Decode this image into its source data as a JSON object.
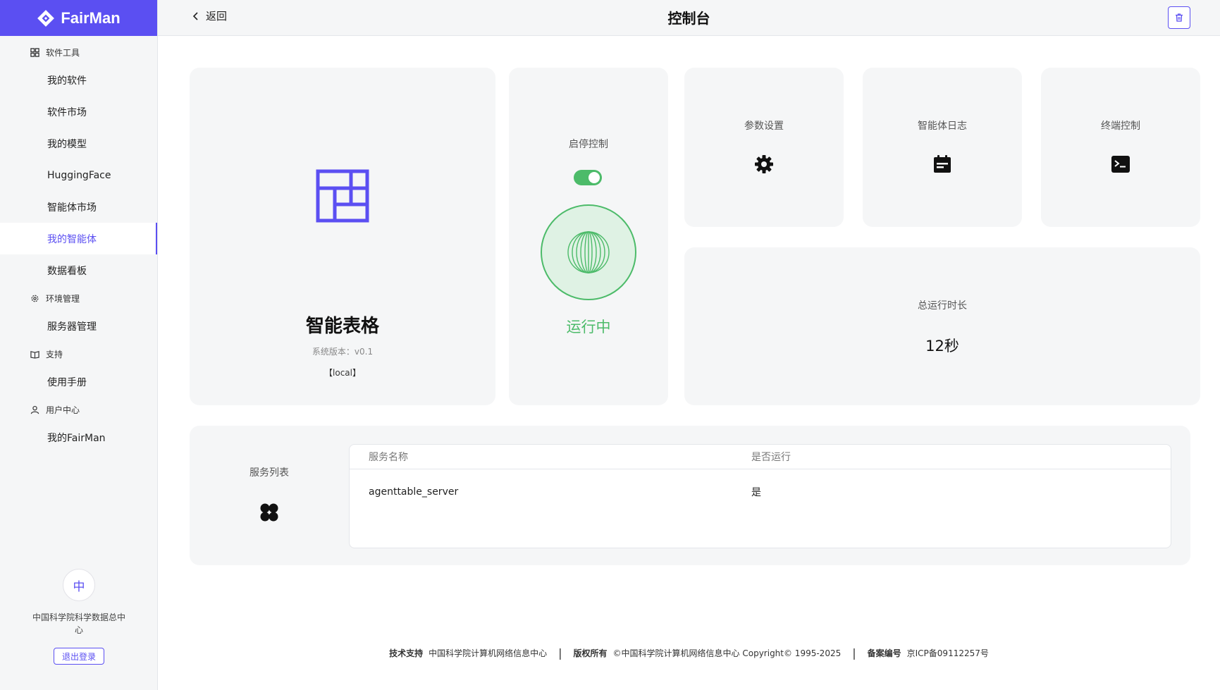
{
  "brand": {
    "name": "FairMan"
  },
  "sidebar": {
    "groups": [
      {
        "title": "软件工具",
        "icon": "grid-icon",
        "items": [
          {
            "label": "我的软件"
          },
          {
            "label": "软件市场"
          },
          {
            "label": "我的模型"
          },
          {
            "label": "HuggingFace"
          },
          {
            "label": "智能体市场"
          },
          {
            "label": "我的智能体",
            "active": true
          },
          {
            "label": "数据看板"
          }
        ]
      },
      {
        "title": "环境管理",
        "icon": "gear-icon",
        "items": [
          {
            "label": "服务器管理"
          }
        ]
      },
      {
        "title": "支持",
        "icon": "book-icon",
        "items": [
          {
            "label": "使用手册"
          }
        ]
      },
      {
        "title": "用户中心",
        "icon": "user-icon",
        "items": [
          {
            "label": "我的FairMan"
          }
        ]
      }
    ],
    "user": {
      "avatar_text": "中",
      "org_name": "中国科学院科学数据总中心",
      "logout_label": "退出登录"
    }
  },
  "header": {
    "back_label": "返回",
    "title": "控制台"
  },
  "app": {
    "name": "智能表格",
    "version": "系统版本：v0.1",
    "env": "【local】"
  },
  "control": {
    "title": "启停控制",
    "enabled": true,
    "status": "运行中"
  },
  "cards": {
    "params": "参数设置",
    "logs": "智能体日志",
    "terminal": "终端控制"
  },
  "runtime": {
    "label": "总运行时长",
    "value": "12秒"
  },
  "services": {
    "label": "服务列表",
    "columns": [
      "服务名称",
      "是否运行"
    ],
    "rows": [
      {
        "name": "agenttable_server",
        "running": "是"
      }
    ]
  },
  "footer": {
    "support_label": "技术支持",
    "support_value": "中国科学院计算机网络信息中心",
    "copyright_label": "版权所有",
    "copyright_value": "©中国科学院计算机网络信息中心 Copyright© 1995-2025",
    "icp_label": "备案编号",
    "icp_value": "京ICP备09112257号"
  },
  "colors": {
    "accent": "#5b4ff2",
    "running": "#4cbb69",
    "panel": "#f5f6f7"
  }
}
